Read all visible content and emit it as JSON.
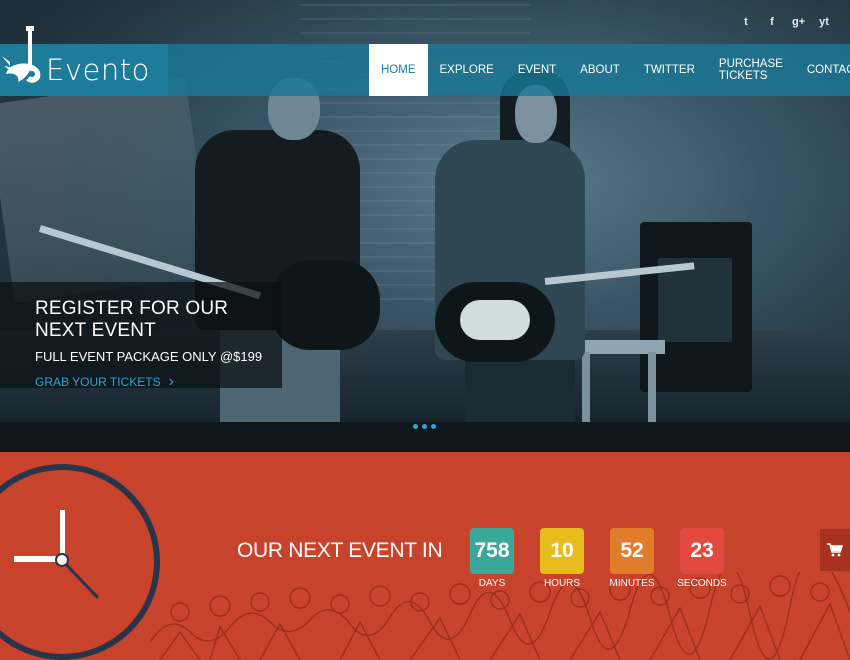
{
  "social": {
    "twitter": "t",
    "facebook": "f",
    "googleplus": "g+",
    "youtube": "yt"
  },
  "logo": {
    "name": "Evento"
  },
  "nav": {
    "items": [
      {
        "label": "HOME"
      },
      {
        "label": "EXPLORE"
      },
      {
        "label": "EVENT"
      },
      {
        "label": "ABOUT"
      },
      {
        "label": "TWITTER"
      },
      {
        "label": "PURCHASE TICKETS"
      },
      {
        "label": "CONTACT"
      }
    ],
    "active_index": 0
  },
  "promo": {
    "title": "REGISTER FOR OUR NEXT EVENT",
    "subtitle": "FULL EVENT PACKAGE ONLY @$199",
    "link": "GRAB YOUR TICKETS",
    "link_arrow": "›"
  },
  "countdown": {
    "title": "OUR NEXT EVENT IN",
    "units": [
      {
        "value": "758",
        "label": "DAYS",
        "color": "#3aa898"
      },
      {
        "value": "10",
        "label": "HOURS",
        "color": "#e6bd1c"
      },
      {
        "value": "52",
        "label": "MINUTES",
        "color": "#e27d2c"
      },
      {
        "value": "23",
        "label": "SECONDS",
        "color": "#e34a3f"
      }
    ]
  },
  "colors": {
    "primary": "#1d7c9a",
    "accent": "#2aa7d8",
    "countdown_bg": "#c8432b",
    "clock_ring": "#27344a"
  },
  "icons": {
    "cart": "shopping-cart-icon",
    "logo": "guitar-wing-icon"
  }
}
